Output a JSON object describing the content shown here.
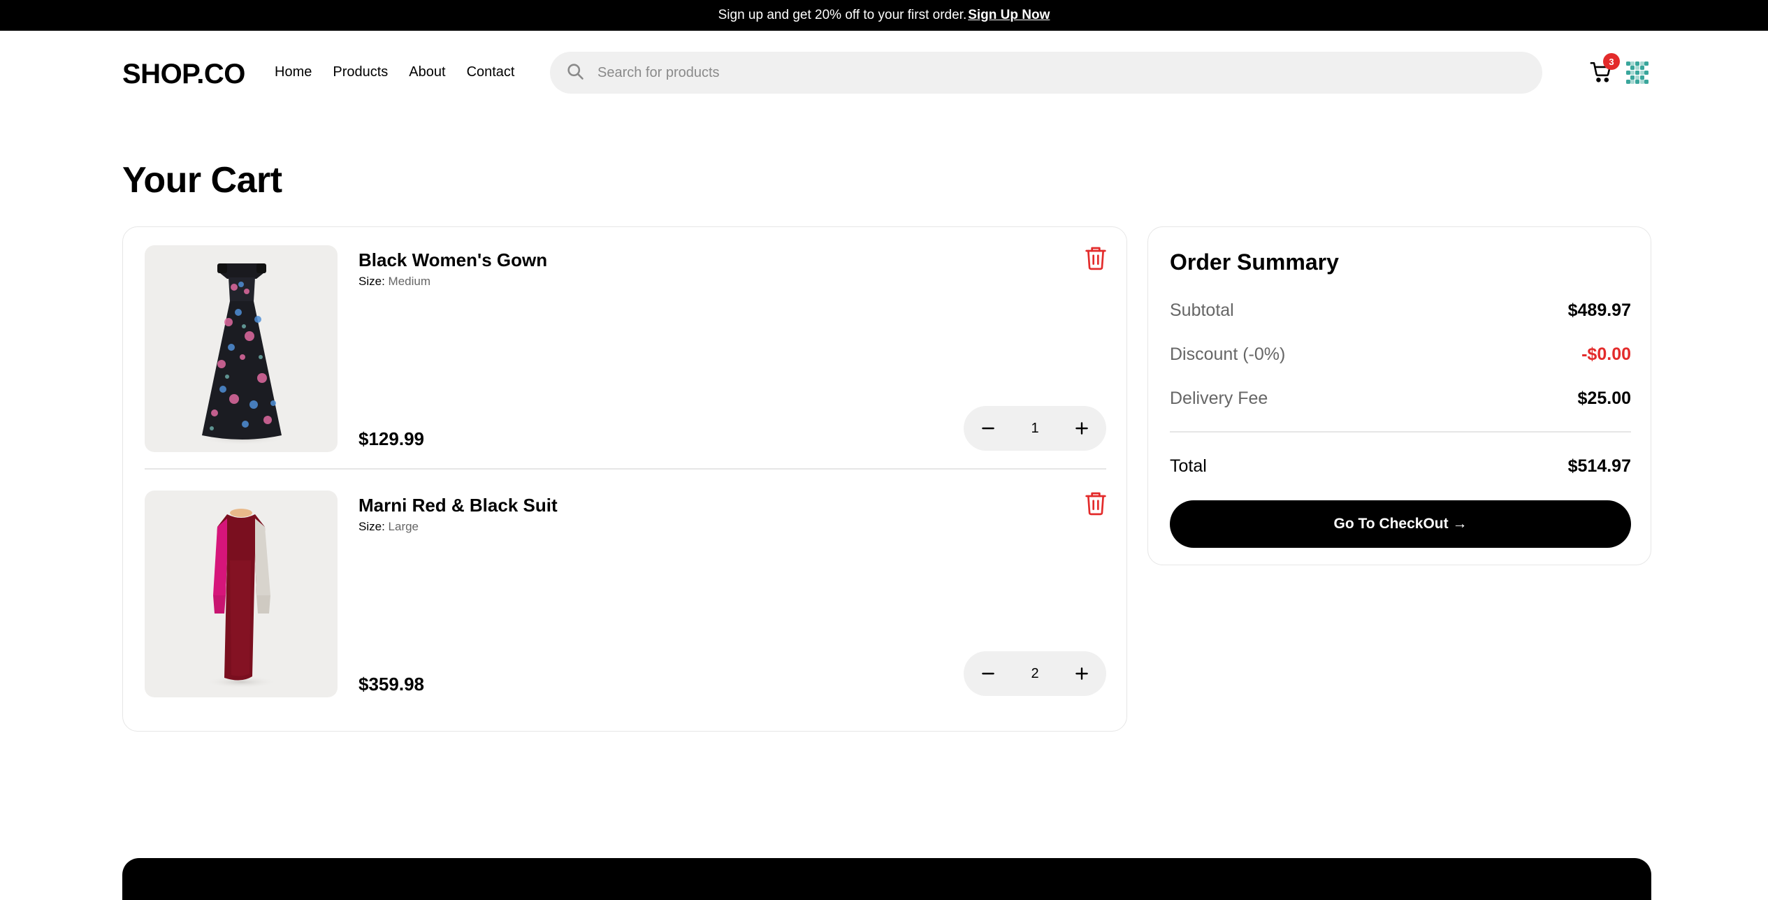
{
  "promo": {
    "text": "Sign up and get 20% off to your first order.",
    "link_label": " Sign Up Now"
  },
  "header": {
    "logo": "SHOP.CO",
    "nav": [
      "Home",
      "Products",
      "About",
      "Contact"
    ],
    "search_placeholder": "Search for products",
    "cart_count": "3",
    "icons": [
      "search-icon",
      "cart-icon",
      "avatar"
    ]
  },
  "page": {
    "title": "Your Cart"
  },
  "cart": {
    "items": [
      {
        "name": "Black Women's Gown",
        "size_label": "Size: ",
        "size": "Medium",
        "price": "$129.99",
        "quantity": "1"
      },
      {
        "name": "Marni Red & Black Suit",
        "size_label": "Size: ",
        "size": "Large",
        "price": "$359.98",
        "quantity": "2"
      }
    ]
  },
  "summary": {
    "title": "Order Summary",
    "subtotal_label": "Subtotal",
    "subtotal": "$489.97",
    "discount_label": "Discount (-0%)",
    "discount": "-$0.00",
    "delivery_label": "Delivery Fee",
    "delivery": "$25.00",
    "total_label": "Total",
    "total": "$514.97",
    "checkout_label": "Go To CheckOut →"
  },
  "colors": {
    "accent_red": "#e32b2b",
    "black": "#000000",
    "muted_bg": "#f0f0f0"
  }
}
